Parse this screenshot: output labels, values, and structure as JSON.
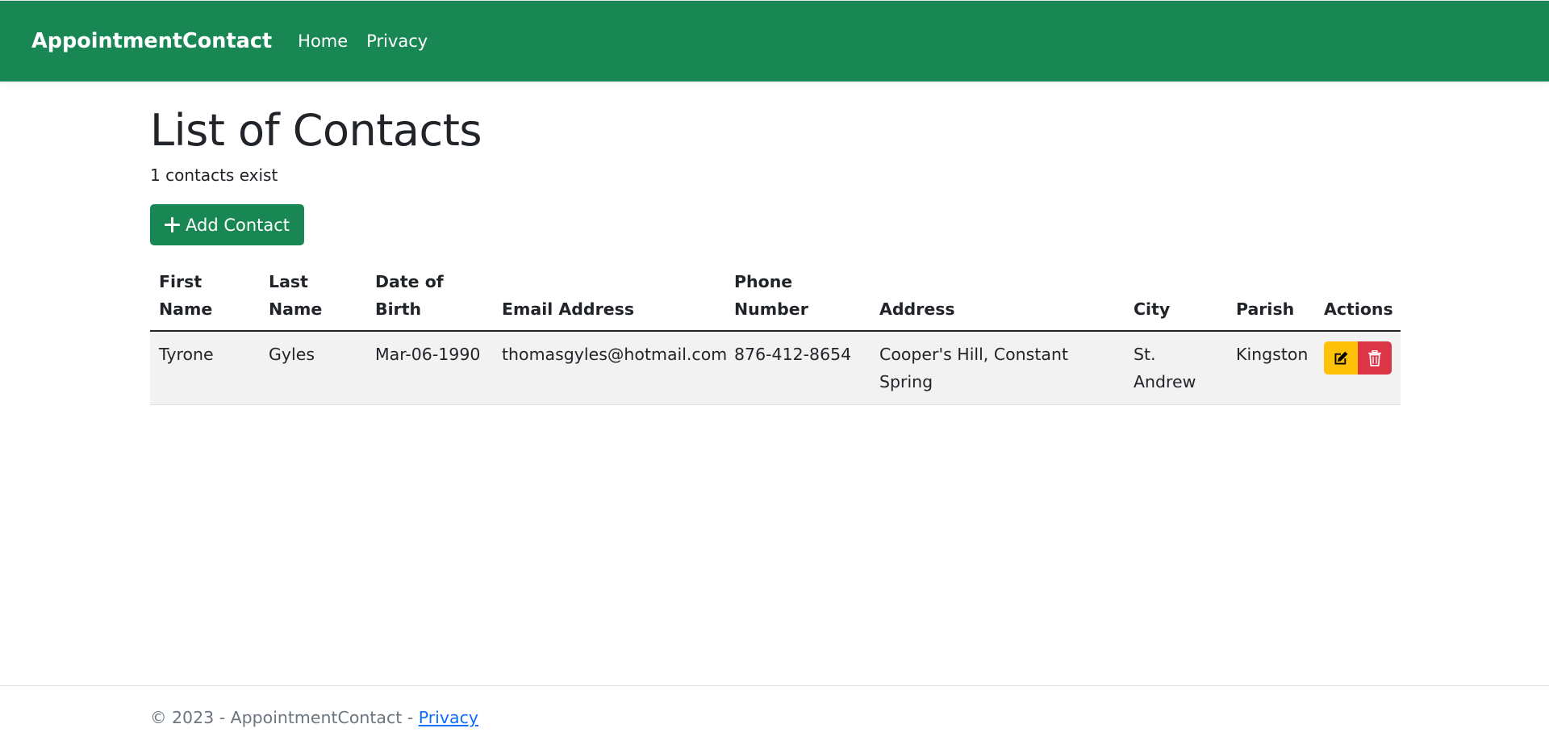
{
  "navbar": {
    "brand": "AppointmentContact",
    "links": [
      "Home",
      "Privacy"
    ],
    "color": "#198754"
  },
  "main": {
    "title": "List of Contacts",
    "count_text": "1 contacts exist",
    "add_button": {
      "label": "Add Contact",
      "icon": "plus-icon"
    }
  },
  "table": {
    "headers": [
      "First Name",
      "Last Name",
      "Date of Birth",
      "Email Address",
      "Phone Number",
      "Address",
      "City",
      "Parish",
      "Actions"
    ],
    "rows": [
      {
        "first_name": "Tyrone",
        "last_name": "Gyles",
        "dob": "Mar-06-1990",
        "email": "thomasgyles@hotmail.com",
        "phone": "876-412-8654",
        "address": "Cooper's Hill, Constant Spring",
        "city": "St. Andrew",
        "parish": "Kingston",
        "actions": {
          "edit_icon": "edit-icon",
          "delete_icon": "trash-icon"
        }
      }
    ]
  },
  "footer": {
    "text": "© 2023 - AppointmentContact - ",
    "link": "Privacy"
  },
  "colors": {
    "primary": "#198754",
    "warning": "#ffc107",
    "danger": "#dc3545",
    "link": "#0d6efd"
  }
}
